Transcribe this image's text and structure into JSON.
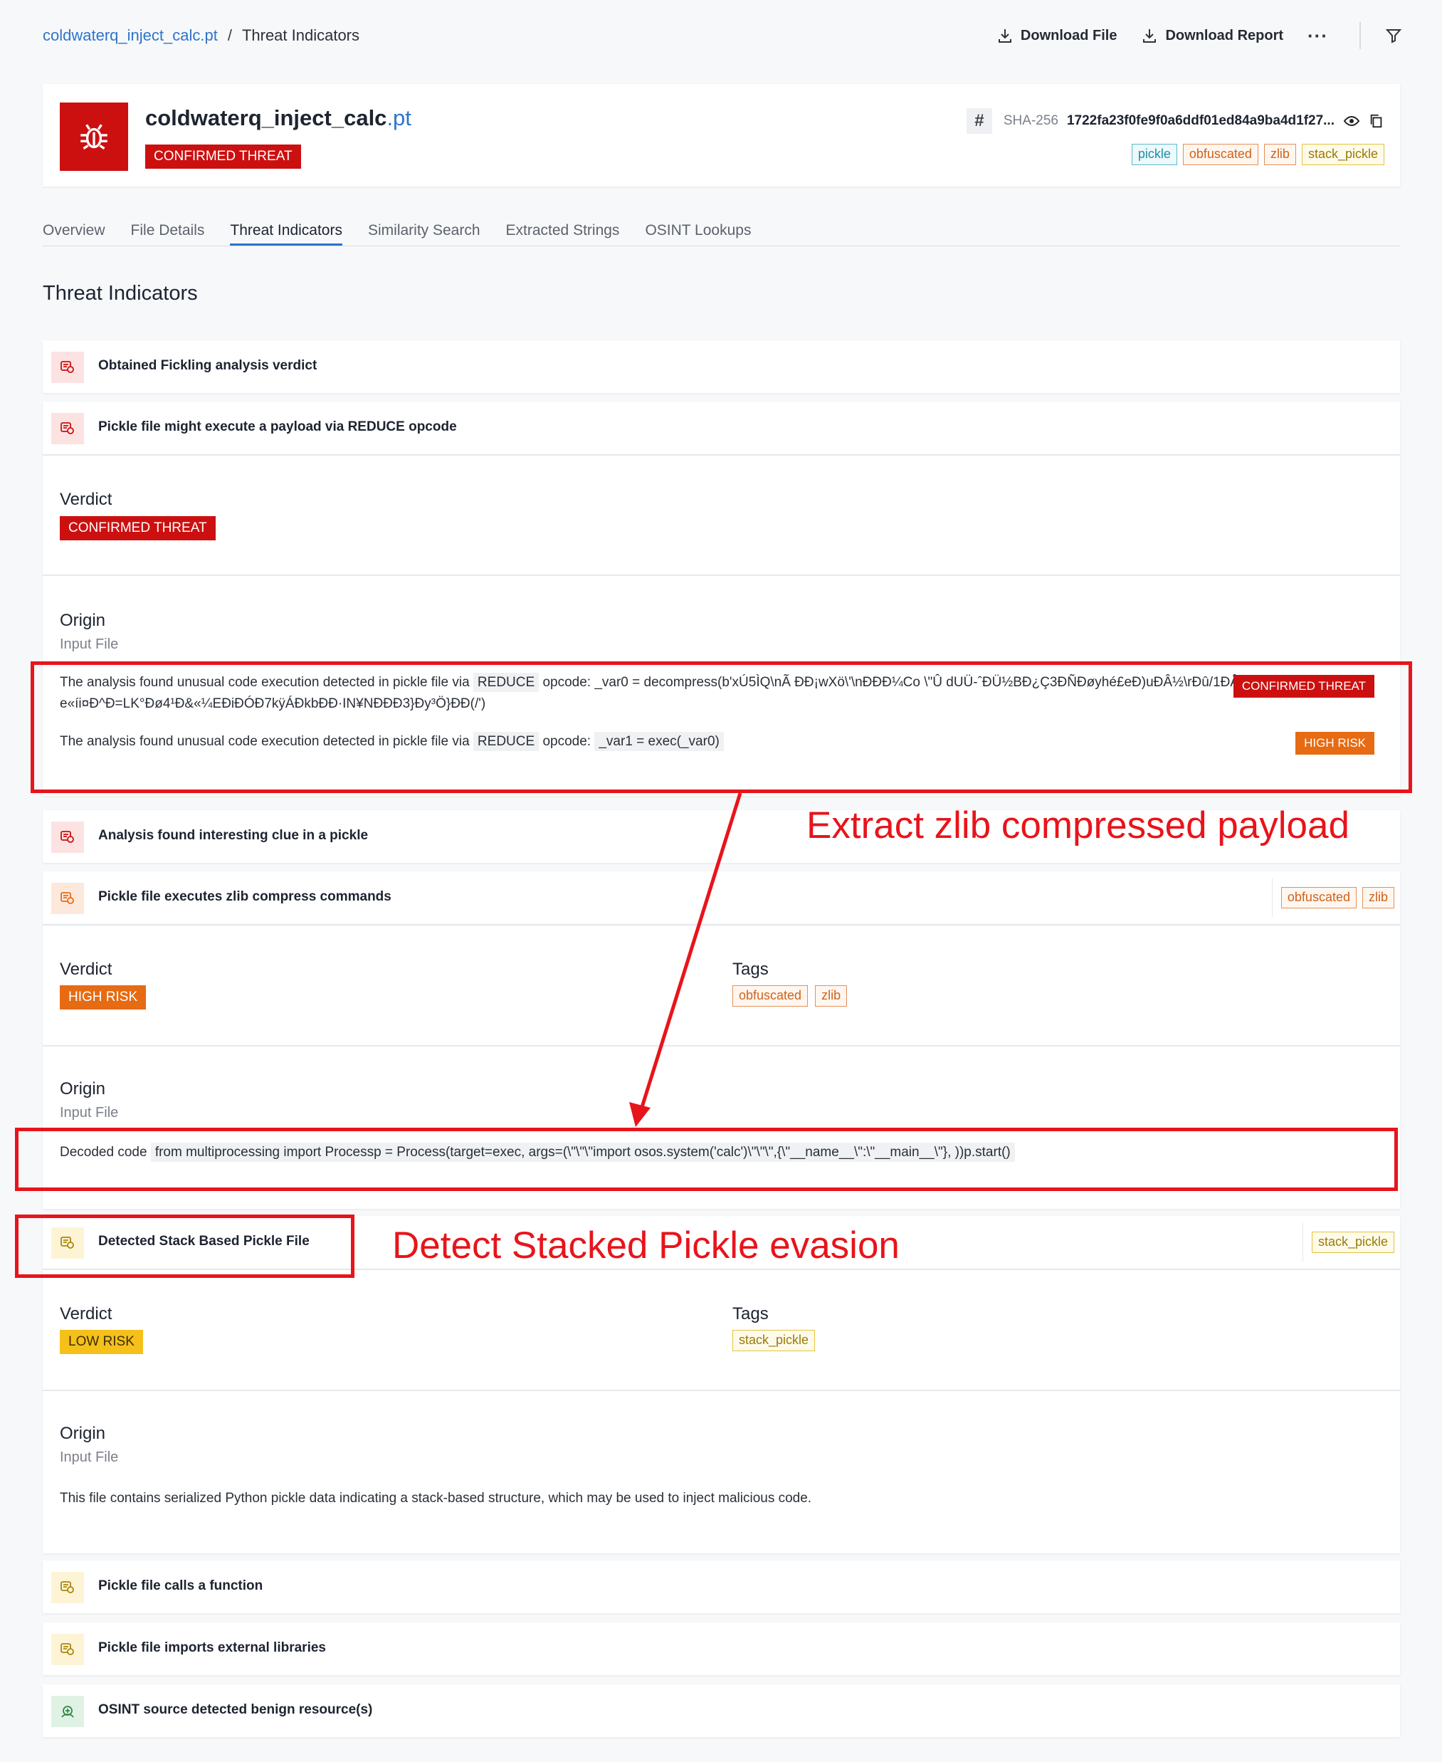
{
  "breadcrumb": {
    "file": "coldwaterq_inject_calc.pt",
    "separator": "/",
    "current": "Threat Indicators"
  },
  "toolbar": {
    "download_file": "Download File",
    "download_report": "Download Report",
    "more": "···"
  },
  "header": {
    "file_name": "coldwaterq_inject_calc",
    "file_ext": ".pt",
    "status": "CONFIRMED THREAT",
    "hash_symbol": "#",
    "hash_label": "SHA-256",
    "hash_value": "1722fa23f0fe9f0a6ddf01ed84a9ba4d1f27...",
    "tags": [
      "pickle",
      "obfuscated",
      "zlib",
      "stack_pickle"
    ]
  },
  "tabs": [
    "Overview",
    "File Details",
    "Threat Indicators",
    "Similarity Search",
    "Extracted Strings",
    "OSINT Lookups"
  ],
  "section_title": "Threat Indicators",
  "indicators": [
    {
      "label": "Obtained Fickling analysis verdict"
    },
    {
      "label": "Pickle file might execute a payload via REDUCE opcode"
    },
    {
      "label": "Analysis found interesting clue in a pickle"
    },
    {
      "label": "Pickle file executes zlib compress commands",
      "tags": [
        "obfuscated",
        "zlib"
      ]
    },
    {
      "label": "Detected Stack Based Pickle File",
      "tags": [
        "stack_pickle"
      ]
    },
    {
      "label": "Pickle file calls a function"
    },
    {
      "label": "Pickle file imports external libraries"
    },
    {
      "label": "OSINT source detected benign resource(s)"
    }
  ],
  "reduce_panel": {
    "verdict_label": "Verdict",
    "verdict": "CONFIRMED THREAT",
    "origin_label": "Origin",
    "origin": "Input File",
    "findings": [
      {
        "prefix": "The analysis found unusual code execution detected in pickle file via",
        "opcode": "REDUCE",
        "mid": "opcode:",
        "code": "_var0 = decompress(b'xÚ5ÌQ\\nÃ ÐÐ¡wXö\\'\\nÐÐÐ¼Co \\\"Û dUÜ-ˆÐÜ½BÐ¿Ç3ÐÑÐøyhé£eÐ)uÐÂ½\\rÐû/1ÐÂ",
        "code2": "e«íi¤Ð^Ð=LK°Ðø4¹Ð&«¼EÐiÐÓÐ7kÿÁÐkbÐÐ·IN¥NÐÐÐ3}Ðy³Ö}ÐÐ(/')",
        "severity": "CONFIRMED THREAT"
      },
      {
        "prefix": "The analysis found unusual code execution detected in pickle file via",
        "opcode": "REDUCE",
        "mid": "opcode:",
        "code": "_var1 = exec(_var0)",
        "severity": "HIGH RISK"
      }
    ]
  },
  "zlib_panel": {
    "verdict_label": "Verdict",
    "verdict": "HIGH RISK",
    "tags_label": "Tags",
    "tags": [
      "obfuscated",
      "zlib"
    ],
    "origin_label": "Origin",
    "origin": "Input File",
    "decoded_label": "Decoded code",
    "decoded_code": "from multiprocessing import Processp = Process(target=exec, args=(\\\"\\\"\\\"import osos.system('calc')\\\"\\\"\\\",{\\\"__name__\\\":\\\"__main__\\\"}, ))p.start()"
  },
  "stack_panel": {
    "verdict_label": "Verdict",
    "verdict": "LOW RISK",
    "tags_label": "Tags",
    "tags": [
      "stack_pickle"
    ],
    "origin_label": "Origin",
    "origin": "Input File",
    "description": "This file contains serialized Python pickle data indicating a stack-based structure, which may be used to inject malicious code."
  },
  "annotations": {
    "zlib": "Extract zlib compressed payload",
    "stacked": "Detect Stacked Pickle evasion"
  },
  "colors": {
    "red": "#cc1010",
    "orange": "#e66b13",
    "yellow": "#f6c01b",
    "link": "#2f74c9",
    "annotation": "#e8141b"
  }
}
